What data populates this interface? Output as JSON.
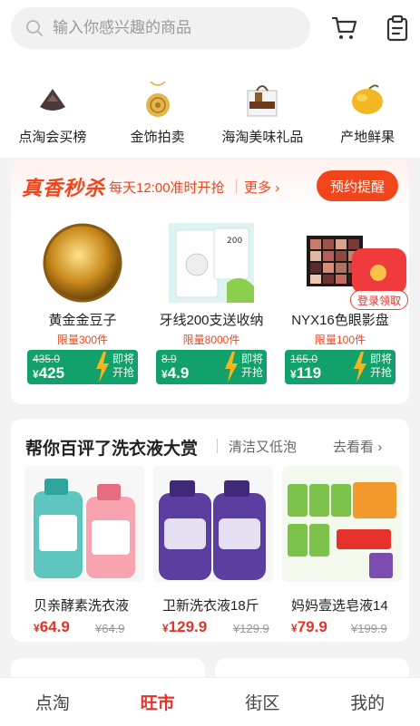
{
  "search": {
    "placeholder": "输入你感兴趣的商品"
  },
  "header_icons": [
    "cart-icon",
    "clipboard-icon"
  ],
  "categories": [
    {
      "label": "点淘会买榜",
      "icon": "black-pouch-icon"
    },
    {
      "label": "金饰拍卖",
      "icon": "gold-pendant-icon"
    },
    {
      "label": "海淘美味礼品",
      "icon": "gift-bag-icon"
    },
    {
      "label": "产地鲜果",
      "icon": "mango-icon"
    }
  ],
  "flash_sale": {
    "title": "真香秒杀",
    "schedule": "每天12:00准时开抢",
    "more": "更多",
    "remind_button": "预约提醒",
    "products": [
      {
        "name": "黄金金豆子",
        "limit": "限量300件",
        "original_price": "435.0",
        "price_currency": "¥",
        "price": "425",
        "status": "即将开抢"
      },
      {
        "name": "牙线200支送收纳",
        "limit": "限量8000件",
        "original_price": "8.9",
        "price_currency": "¥",
        "price": "4.9",
        "status": "即将开抢"
      },
      {
        "name": "NYX16色眼影盘",
        "limit": "限量100件",
        "original_price": "165.0",
        "price_currency": "¥",
        "price": "119",
        "status": "即将开抢"
      }
    ],
    "red_packet_label": "登录领取"
  },
  "detergent": {
    "title": "帮你百评了洗衣液大赏",
    "subtitle": "清洁又低泡",
    "more": "去看看",
    "products": [
      {
        "name": "贝亲酵素洗衣液",
        "price_currency": "¥",
        "price": "64.9",
        "original_price": "¥64.9"
      },
      {
        "name": "卫新洗衣液18斤",
        "price_currency": "¥",
        "price": "129.9",
        "original_price": "¥129.9"
      },
      {
        "name": "妈妈壹选皂液14",
        "price_currency": "¥",
        "price": "79.9",
        "original_price": "¥199.9"
      }
    ]
  },
  "tabs": [
    {
      "label": "点淘",
      "active": false
    },
    {
      "label": "旺市",
      "active": true
    },
    {
      "label": "街区",
      "active": false
    },
    {
      "label": "我的",
      "active": false
    }
  ],
  "colors": {
    "accent": "#f1461c",
    "price_red": "#e4322b",
    "sale_green": "#12a06b"
  }
}
